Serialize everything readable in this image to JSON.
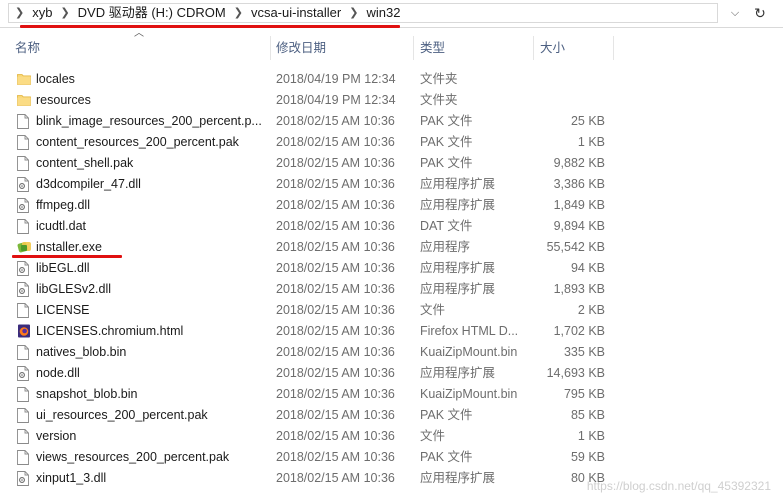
{
  "address": {
    "crumbs": [
      "xyb",
      "DVD 驱动器 (H:) CDROM",
      "vcsa-ui-installer",
      "win32"
    ]
  },
  "columns": {
    "name": "名称",
    "date": "修改日期",
    "type": "类型",
    "size": "大小"
  },
  "files": [
    {
      "name": "locales",
      "date": "2018/04/19 PM 12:34",
      "type": "文件夹",
      "size": "",
      "icon": "folder"
    },
    {
      "name": "resources",
      "date": "2018/04/19 PM 12:34",
      "type": "文件夹",
      "size": "",
      "icon": "folder"
    },
    {
      "name": "blink_image_resources_200_percent.p...",
      "date": "2018/02/15 AM 10:36",
      "type": "PAK 文件",
      "size": "25 KB",
      "icon": "file"
    },
    {
      "name": "content_resources_200_percent.pak",
      "date": "2018/02/15 AM 10:36",
      "type": "PAK 文件",
      "size": "1 KB",
      "icon": "file"
    },
    {
      "name": "content_shell.pak",
      "date": "2018/02/15 AM 10:36",
      "type": "PAK 文件",
      "size": "9,882 KB",
      "icon": "file"
    },
    {
      "name": "d3dcompiler_47.dll",
      "date": "2018/02/15 AM 10:36",
      "type": "应用程序扩展",
      "size": "3,386 KB",
      "icon": "dll"
    },
    {
      "name": "ffmpeg.dll",
      "date": "2018/02/15 AM 10:36",
      "type": "应用程序扩展",
      "size": "1,849 KB",
      "icon": "dll"
    },
    {
      "name": "icudtl.dat",
      "date": "2018/02/15 AM 10:36",
      "type": "DAT 文件",
      "size": "9,894 KB",
      "icon": "file"
    },
    {
      "name": "installer.exe",
      "date": "2018/02/15 AM 10:36",
      "type": "应用程序",
      "size": "55,542 KB",
      "icon": "exe"
    },
    {
      "name": "libEGL.dll",
      "date": "2018/02/15 AM 10:36",
      "type": "应用程序扩展",
      "size": "94 KB",
      "icon": "dll"
    },
    {
      "name": "libGLESv2.dll",
      "date": "2018/02/15 AM 10:36",
      "type": "应用程序扩展",
      "size": "1,893 KB",
      "icon": "dll"
    },
    {
      "name": "LICENSE",
      "date": "2018/02/15 AM 10:36",
      "type": "文件",
      "size": "2 KB",
      "icon": "file"
    },
    {
      "name": "LICENSES.chromium.html",
      "date": "2018/02/15 AM 10:36",
      "type": "Firefox HTML D...",
      "size": "1,702 KB",
      "icon": "firefox"
    },
    {
      "name": "natives_blob.bin",
      "date": "2018/02/15 AM 10:36",
      "type": "KuaiZipMount.bin",
      "size": "335 KB",
      "icon": "file"
    },
    {
      "name": "node.dll",
      "date": "2018/02/15 AM 10:36",
      "type": "应用程序扩展",
      "size": "14,693 KB",
      "icon": "dll"
    },
    {
      "name": "snapshot_blob.bin",
      "date": "2018/02/15 AM 10:36",
      "type": "KuaiZipMount.bin",
      "size": "795 KB",
      "icon": "file"
    },
    {
      "name": "ui_resources_200_percent.pak",
      "date": "2018/02/15 AM 10:36",
      "type": "PAK 文件",
      "size": "85 KB",
      "icon": "file"
    },
    {
      "name": "version",
      "date": "2018/02/15 AM 10:36",
      "type": "文件",
      "size": "1 KB",
      "icon": "file"
    },
    {
      "name": "views_resources_200_percent.pak",
      "date": "2018/02/15 AM 10:36",
      "type": "PAK 文件",
      "size": "59 KB",
      "icon": "file"
    },
    {
      "name": "xinput1_3.dll",
      "date": "2018/02/15 AM 10:36",
      "type": "应用程序扩展",
      "size": "80 KB",
      "icon": "dll"
    }
  ],
  "watermark": "https://blog.csdn.net/qq_45392321",
  "colors": {
    "annotation": "#e01010",
    "folder": "#f8d775",
    "header_text": "#4d6082"
  }
}
